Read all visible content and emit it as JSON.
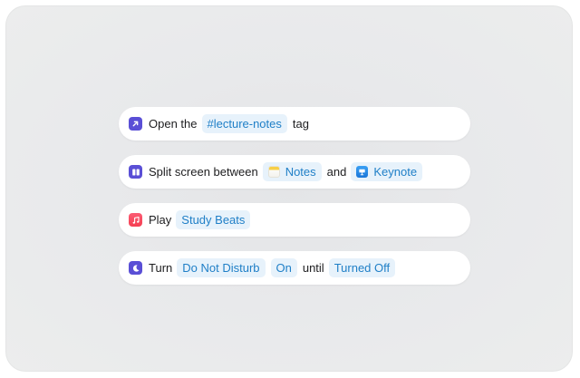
{
  "rows": [
    {
      "icon": "open-arrow-icon",
      "parts": {
        "t1": "Open the",
        "tok1": "#lecture-notes",
        "t2": "tag"
      }
    },
    {
      "icon": "split-screen-icon",
      "parts": {
        "t1": "Split screen between",
        "tok1": "Notes",
        "tok1_icon": "notes-app-icon",
        "t2": "and",
        "tok2": "Keynote",
        "tok2_icon": "keynote-app-icon"
      }
    },
    {
      "icon": "music-icon",
      "parts": {
        "t1": "Play",
        "tok1": "Study Beats"
      }
    },
    {
      "icon": "moon-icon",
      "parts": {
        "t1": "Turn",
        "tok1": "Do Not Disturb",
        "tok2": "On",
        "t2": "until",
        "tok3": "Turned Off"
      }
    }
  ],
  "colors": {
    "accent_purple": "#5a4fd6",
    "token_bg": "#e7f2fb",
    "token_text": "#1f7fc7",
    "music_red": "#f53f52",
    "background": "#e8e9eb"
  }
}
